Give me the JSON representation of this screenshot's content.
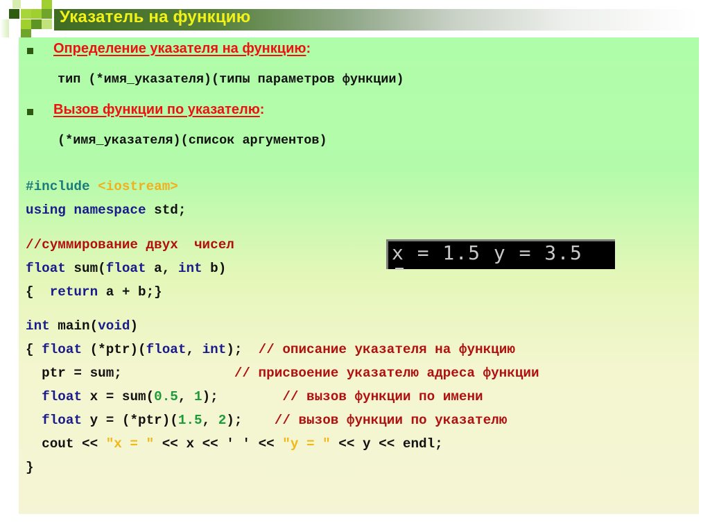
{
  "slide": {
    "title": "Указатель на функцию",
    "colors": {
      "title_text": "#f2f21a",
      "title_bar": "#3f6b22",
      "heading": "#ee1111",
      "keyword": "#1a1a8c",
      "comment": "#b01010",
      "number": "#1e9a3a",
      "string": "#f2b818"
    },
    "bullets": [
      {
        "heading": "Определение указателя на функцию",
        "suffix": ":",
        "syntax": "тип (*имя_указателя)(типы параметров функции)"
      },
      {
        "heading": "Вызов функции по указателю",
        "suffix": ":",
        "syntax": "(*имя_указателя)(список аргументов)"
      }
    ],
    "code": {
      "include_directive": "#include",
      "include_header": "<iostream>",
      "using_kw": "using namespace",
      "using_rest": " std;",
      "comment_sum": "//суммирование двух  чисел",
      "sum_sig": {
        "kw1": "float",
        "mid1": " sum(",
        "kw2": "float",
        "mid2": " a, ",
        "kw3": "int",
        "mid3": " b)"
      },
      "sum_body": {
        "open": "{  ",
        "kw": "return",
        "rest": " a + b;}"
      },
      "main_sig": {
        "kw1": "int",
        "mid": " main(",
        "kw2": "void",
        "close": ")"
      },
      "line_decl": {
        "open": "{ ",
        "kw1": "float",
        "mid": " (*ptr)(",
        "kw2": "float",
        "comma": ", ",
        "kw3": "int",
        "close": ");  ",
        "comment": "// описание указателя на функцию"
      },
      "line_assign": {
        "code": "  ptr = sum;              ",
        "comment": "// присвоение указателю адреса функции"
      },
      "line_x": {
        "indent": "  ",
        "kw": "float",
        "mid": " x = sum(",
        "n1": "0.5",
        "comma": ", ",
        "n2": "1",
        "close": ");        ",
        "comment": "// вызов функции по имени"
      },
      "line_y": {
        "indent": "  ",
        "kw": "float",
        "mid": " y = (*ptr)(",
        "n1": "1.5",
        "comma": ", ",
        "n2": "2",
        "close": ");    ",
        "comment": "// вызов функции по указателю"
      },
      "line_cout": {
        "p1": "  cout << ",
        "s1": "\"x = \"",
        "p2": " << x << ' ' << ",
        "s2": "\"y = \"",
        "p3": " << y << endl;"
      },
      "close_brace": "}"
    },
    "console_output": "x = 1.5 y = 3.5"
  }
}
